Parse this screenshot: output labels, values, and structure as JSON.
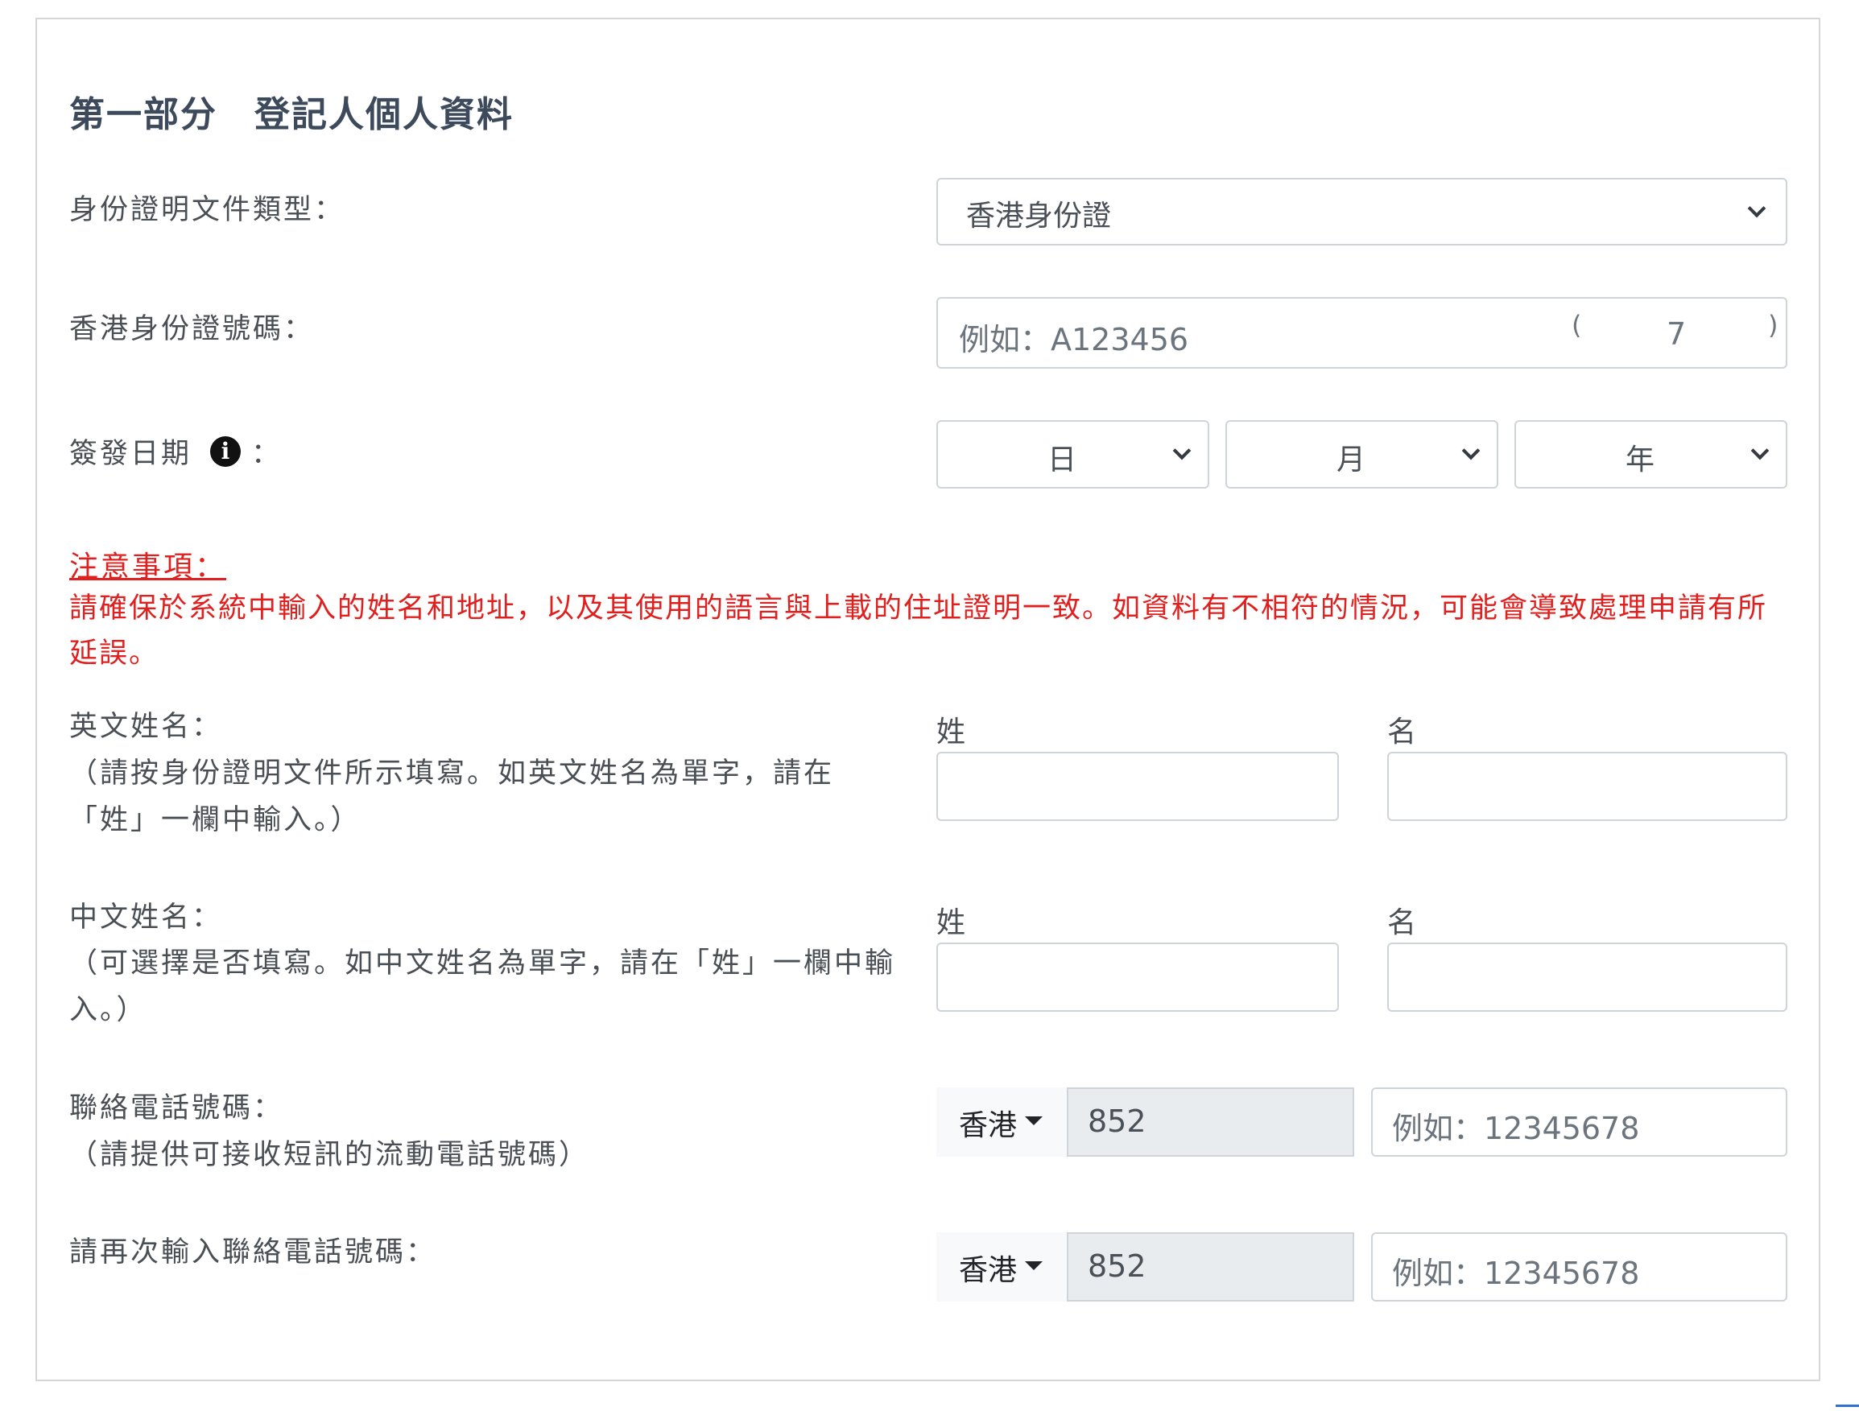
{
  "section": {
    "title": "第一部分　登記人個人資料"
  },
  "id_type": {
    "label": "身份證明文件類型：",
    "selected": "香港身份證"
  },
  "hkid": {
    "label": "香港身份證號碼：",
    "placeholder": "例如：A123456",
    "check_open": "(",
    "check_digit": "7",
    "check_close": ")"
  },
  "issue_date": {
    "label": "簽發日期",
    "colon": "：",
    "info_glyph": "i",
    "day": "日",
    "month": "月",
    "year": "年"
  },
  "notice": {
    "heading": "注意事項：",
    "body": "請確保於系統中輸入的姓名和地址，以及其使用的語言與上載的住址證明一致。如資料有不相符的情況，可能會導致處理申請有所延誤。"
  },
  "english_name": {
    "label": "英文姓名：",
    "hint": "（請按身份證明文件所示填寫。如英文姓名為單字，請在「姓」一欄中輸入。）",
    "surname_label": "姓",
    "given_label": "名"
  },
  "chinese_name": {
    "label": "中文姓名：",
    "hint": "（可選擇是否填寫。如中文姓名為單字，請在「姓」一欄中輸入。）",
    "surname_label": "姓",
    "given_label": "名"
  },
  "phone": {
    "label": "聯絡電話號碼：",
    "hint": "（請提供可接收短訊的流動電話號碼）",
    "country": "香港",
    "code": "852",
    "placeholder": "例如：12345678"
  },
  "phone_confirm": {
    "label": "請再次輸入聯絡電話號碼：",
    "country": "香港",
    "code": "852",
    "placeholder": "例如：12345678"
  },
  "icons": {
    "chevron": "chevron-down-icon",
    "info": "info-icon",
    "caret": "caret-down-icon"
  },
  "colors": {
    "notice_red": "#e0201f",
    "title": "#3d4a5c",
    "code_bg": "#e9ecef"
  }
}
